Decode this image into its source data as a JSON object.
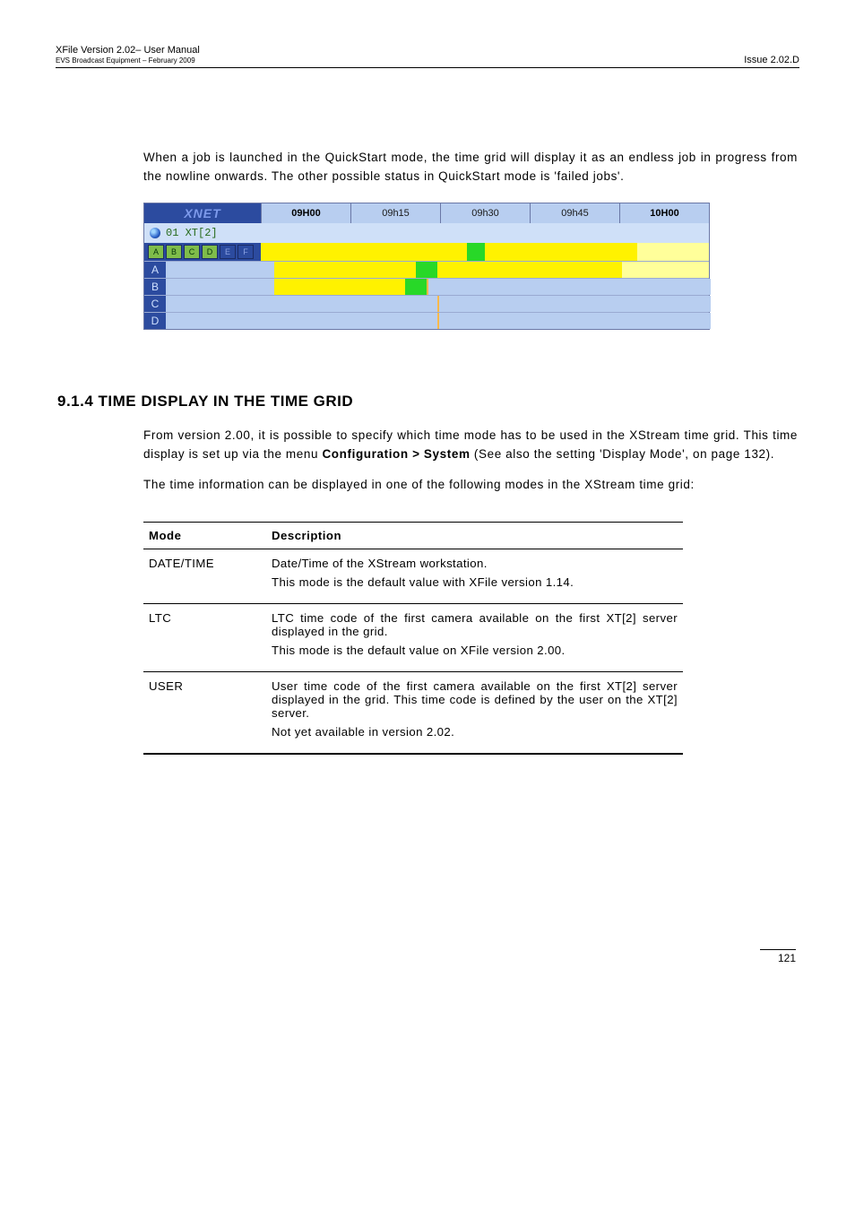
{
  "header": {
    "left_line1": "XFile Version 2.02– User Manual",
    "left_line2": "EVS Broadcast Equipment – February 2009",
    "right": "Issue 2.02.D"
  },
  "intro_para": "When a job is launched in the QuickStart mode, the time grid will display it as an endless job in progress from the nowline onwards. The other possible status in QuickStart mode is 'failed jobs'.",
  "grid": {
    "brand": "XNET",
    "times": [
      "09H00",
      "09h15",
      "09h30",
      "09h45",
      "10H00"
    ],
    "server_label": "01 XT[2]",
    "chan_buttons": [
      "A",
      "B",
      "C",
      "D",
      "E",
      "F"
    ],
    "rows": [
      "A",
      "B",
      "C",
      "D"
    ]
  },
  "section_title": "9.1.4 TIME DISPLAY IN THE TIME GRID",
  "para1": "From version 2.00, it is possible to specify which time mode has to be used in the XStream time grid. This time display is set up via the menu ",
  "para1_b": "Configuration > System",
  "para1_c": " (See also the setting 'Display Mode', on page 132).",
  "para2": "The time information can be displayed in one of the following modes in the XStream time grid:",
  "table": {
    "h1": "Mode",
    "h2": "Description",
    "rows": [
      {
        "mode": "DATE/TIME",
        "lines": [
          "Date/Time of the XStream workstation.",
          "This mode is the default value with XFile version 1.14."
        ]
      },
      {
        "mode": "LTC",
        "lines": [
          "LTC time code of the first camera available on the first XT[2] server displayed in the grid.",
          "This mode is the default value on XFile version 2.00."
        ]
      },
      {
        "mode": "USER",
        "lines": [
          "User time code of the first camera available on the first XT[2] server displayed in the grid. This time code is defined by the user on the XT[2] server.",
          "Not yet available in version 2.02."
        ]
      }
    ]
  },
  "footer_page": "121"
}
